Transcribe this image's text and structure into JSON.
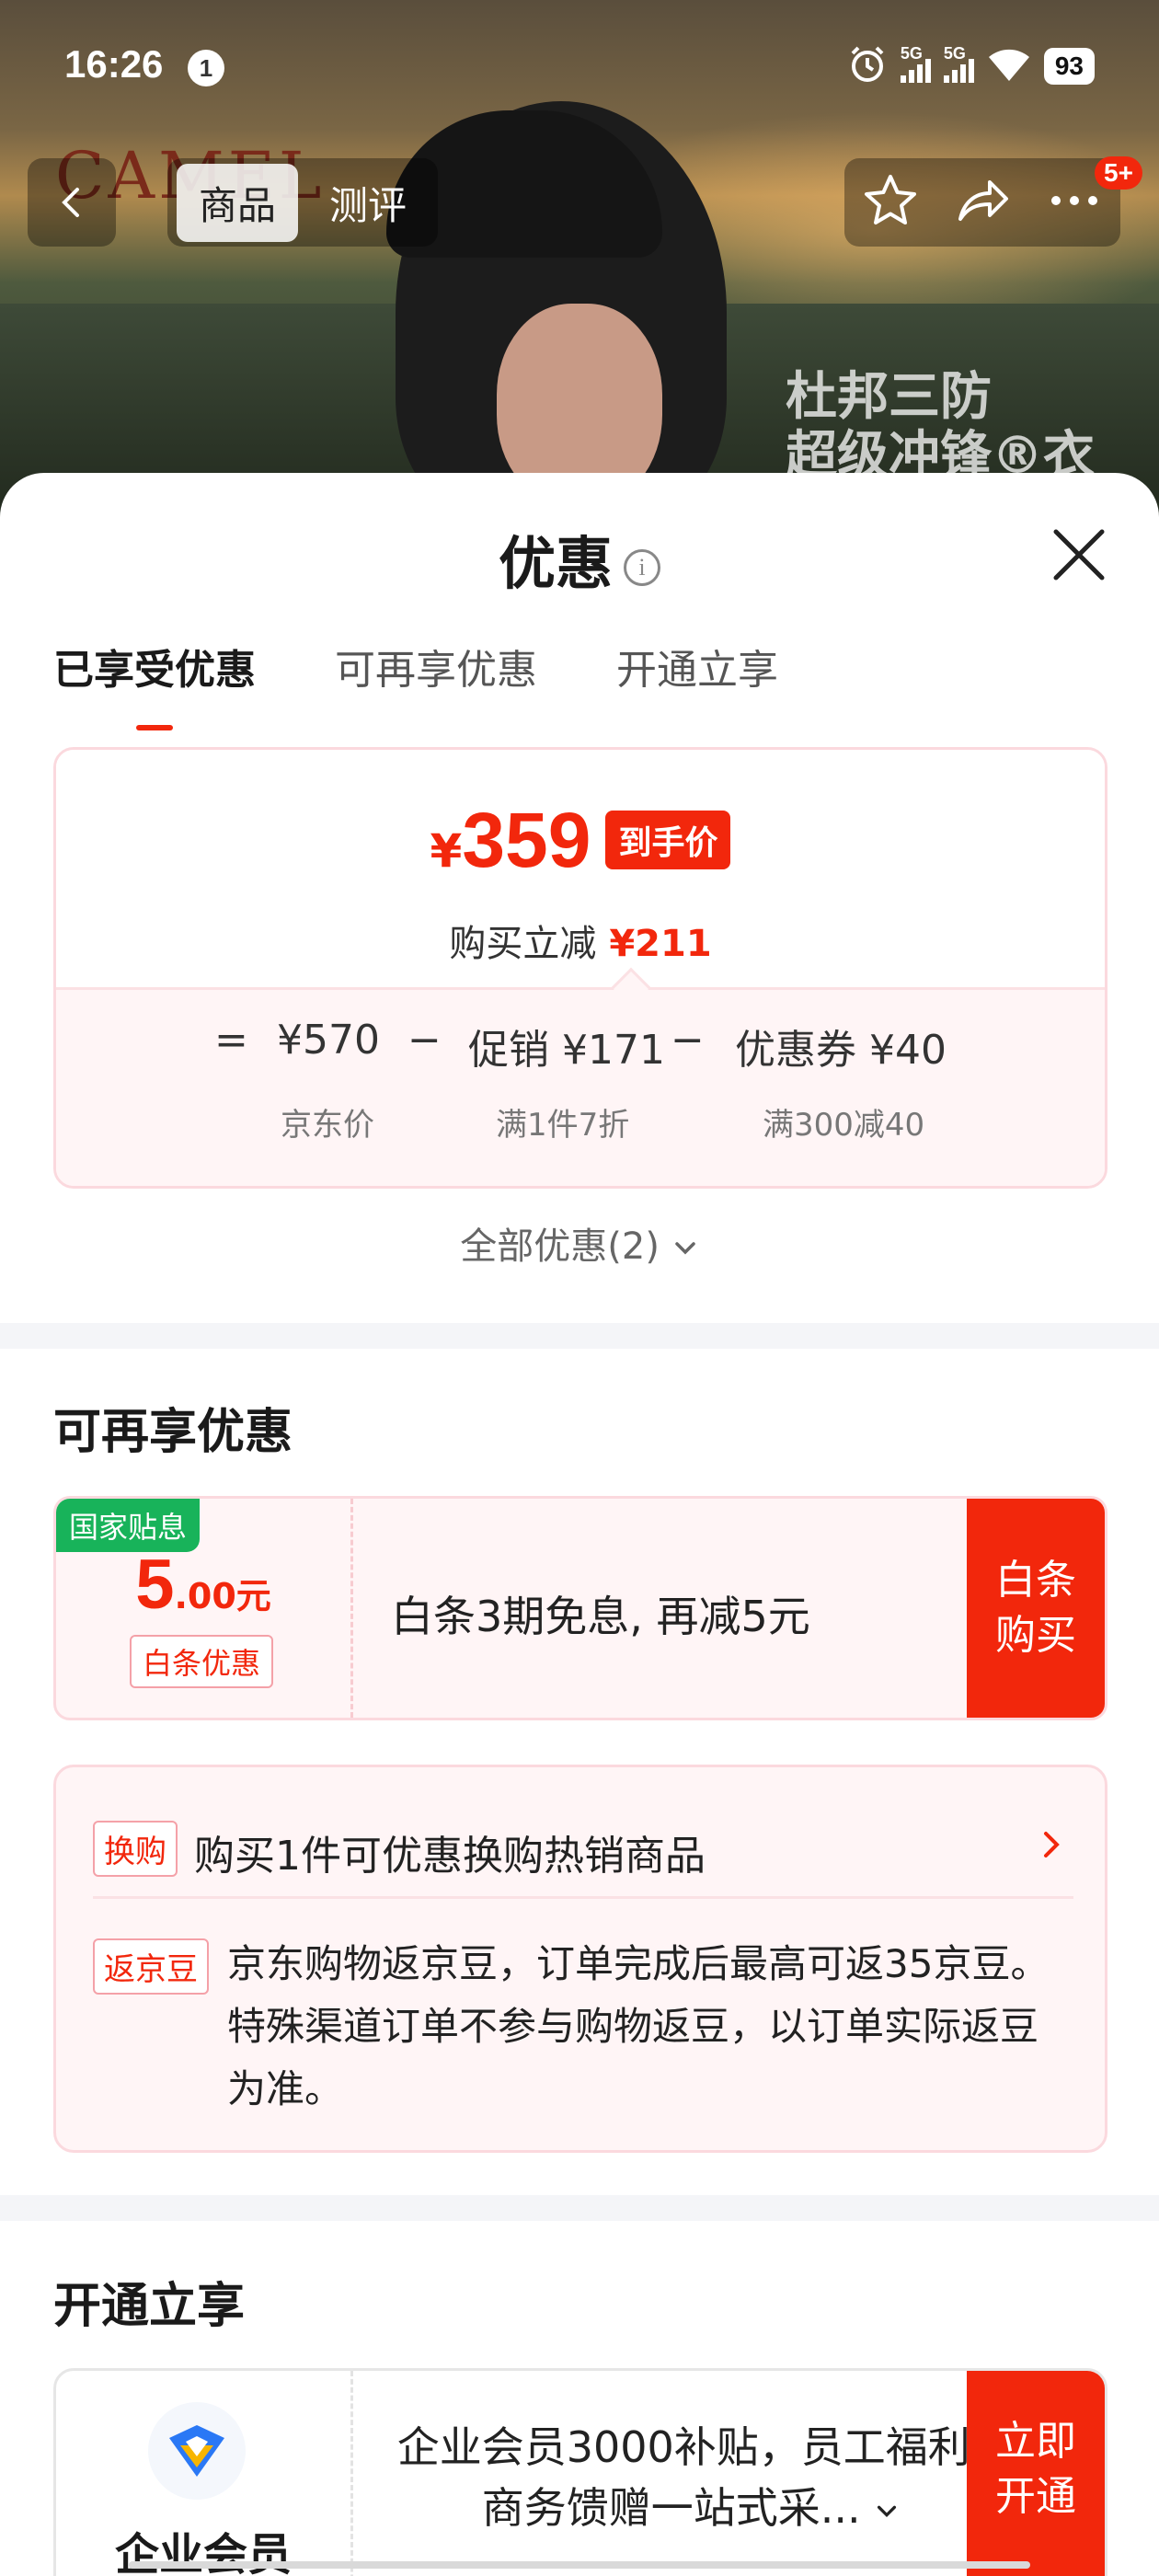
{
  "status_bar": {
    "time": "16:26",
    "notification_count": "1",
    "signal1_label": "5G",
    "signal2_label": "5G",
    "battery": "93"
  },
  "background": {
    "brand_logo": "CAMEL",
    "promo_line1": "杜邦三防",
    "promo_line2": "超级冲锋®衣"
  },
  "top_nav": {
    "tabs": [
      "商品",
      "测评"
    ],
    "active_tab": "商品",
    "badge": "5+"
  },
  "sheet": {
    "title": "优惠",
    "tabs": [
      "已享受优惠",
      "可再享优惠",
      "开通立享"
    ],
    "active_tab": "已享受优惠"
  },
  "price_card": {
    "currency": "¥",
    "final_price": "359",
    "final_tag": "到手价",
    "reduce_label": "购买立减",
    "reduce_amount": "¥211",
    "formula": {
      "equals": "=",
      "jd_price": "¥570",
      "minus1": "−",
      "promo": "促销 ¥171",
      "minus2": "−",
      "coupon": "优惠券 ¥40"
    },
    "sub_labels": {
      "jd_price": "京东价",
      "promo": "满1件7折",
      "coupon": "满300减40"
    }
  },
  "all_offers": "全部优惠(2)",
  "section_more": {
    "title": "可再享优惠",
    "baitiao": {
      "flag": "国家贴息",
      "amount_big": "5",
      "amount_small": ".00元",
      "label": "白条优惠",
      "description": "白条3期免息, 再减5元",
      "button": "白条购买"
    },
    "info": {
      "chip1": "换购",
      "line1": "购买1件可优惠换购热销商品",
      "chip2": "返京豆",
      "paragraph": "京东购物返京豆，订单完成后最高可返35京豆。特殊渠道订单不参与购物返豆，以订单实际返豆为准。"
    }
  },
  "section_open": {
    "title": "开通立享",
    "member": {
      "name": "企业会员",
      "description": "企业会员3000补贴，员工福利/商务馈赠一站式采...",
      "button": "立即开通"
    }
  },
  "colors": {
    "accent": "#f2270c",
    "card_border": "#fbd9de",
    "card_bg": "#fff5f6",
    "green_flag": "#18b35a"
  }
}
